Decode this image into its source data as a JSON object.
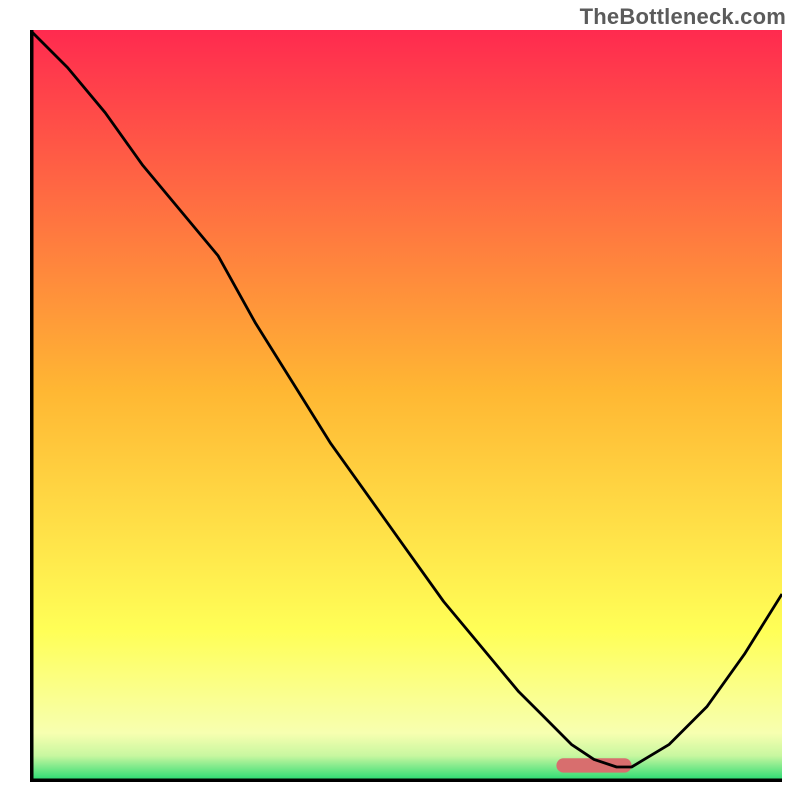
{
  "watermark": "TheBottleneck.com",
  "chart_data": {
    "type": "line",
    "title": "",
    "xlabel": "",
    "ylabel": "",
    "xlim": [
      0,
      100
    ],
    "ylim": [
      0,
      100
    ],
    "grid": false,
    "legend": false,
    "background_gradient": {
      "top": "#ff2a4f",
      "mid_upper": "#ffb733",
      "mid_lower": "#ffff57",
      "bottom": "#1dd86f"
    },
    "series": [
      {
        "name": "bottleneck-curve",
        "x": [
          0,
          5,
          10,
          15,
          20,
          25,
          30,
          35,
          40,
          45,
          50,
          55,
          60,
          65,
          68,
          72,
          75,
          78,
          80,
          85,
          90,
          95,
          100
        ],
        "y": [
          100,
          95,
          89,
          82,
          76,
          70,
          61,
          53,
          45,
          38,
          31,
          24,
          18,
          12,
          9,
          5,
          3,
          2,
          2,
          5,
          10,
          17,
          25
        ],
        "color": "#000000",
        "width": 1.4
      }
    ],
    "minimum_band": {
      "x_start": 70,
      "x_end": 80,
      "y": 2.2,
      "color": "#d86e6e",
      "thickness": 4.8
    },
    "axes": {
      "color": "#000000",
      "line_width": 3.5
    }
  }
}
